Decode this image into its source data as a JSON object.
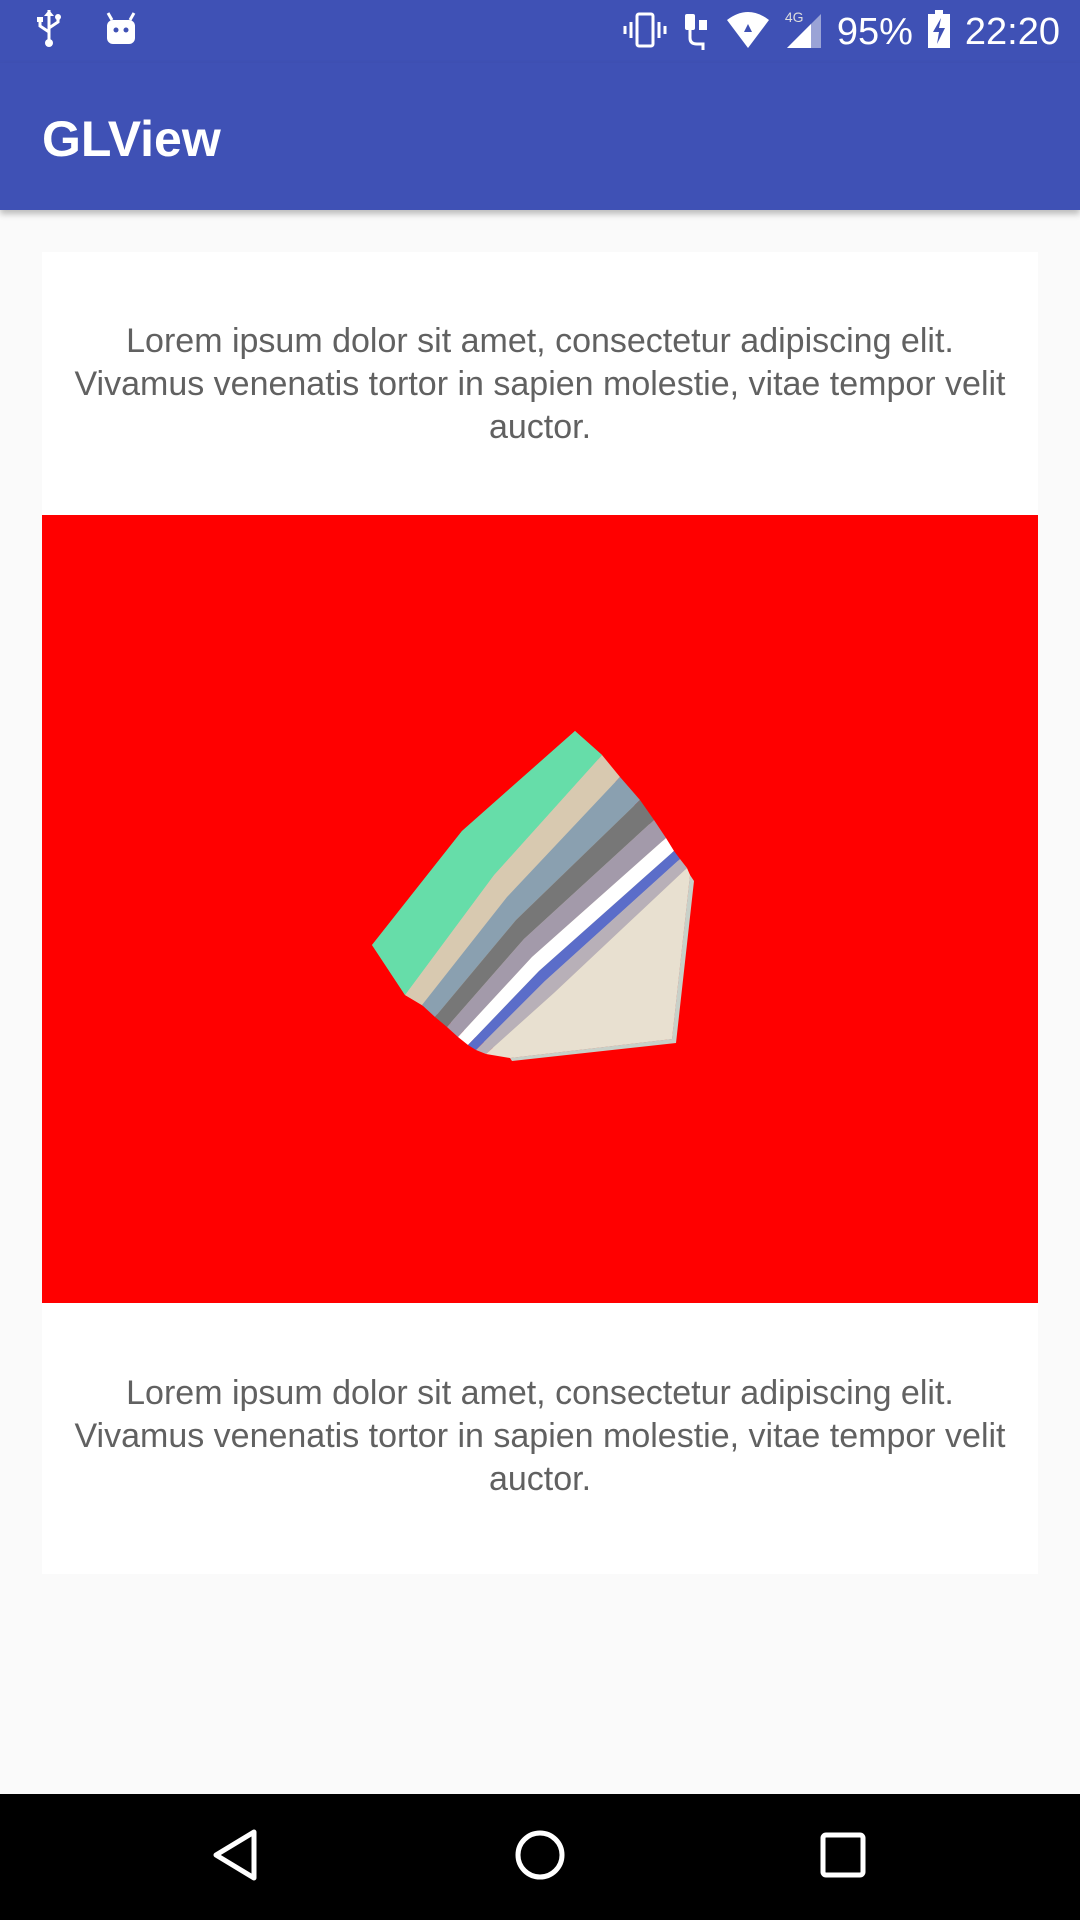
{
  "status_bar": {
    "battery_percent": "95%",
    "time": "22:20",
    "network_label": "4G",
    "icons": [
      "usb-icon",
      "android-debug-icon",
      "vibrate-icon",
      "headset-icon",
      "wifi-icon",
      "cell-signal-icon",
      "battery-charging-icon"
    ]
  },
  "app_bar": {
    "title": "GLView"
  },
  "content": {
    "paragraph_top": "Lorem ipsum dolor sit amet, consectetur adipiscing elit. Vivamus venenatis tortor in sapien molestie, vitae tempor velit auctor.",
    "paragraph_bottom": "Lorem ipsum dolor sit amet, consectetur adipiscing elit. Vivamus venenatis tortor in sapien molestie, vitae tempor velit auctor."
  },
  "gl_view": {
    "background_color": "#ff0000",
    "shape_colors": [
      "#66dda9",
      "#d8c9b0",
      "#8aa0b0",
      "#777777",
      "#a39aaa",
      "#ffffff",
      "#5b6dc9",
      "#b8b0b8",
      "#e8e0d0",
      "#c8d0c8"
    ]
  },
  "nav_bar": {
    "icons": [
      "back-icon",
      "home-icon",
      "recents-icon"
    ]
  },
  "colors": {
    "primary": "#3F51B5",
    "text_secondary": "#616161"
  }
}
